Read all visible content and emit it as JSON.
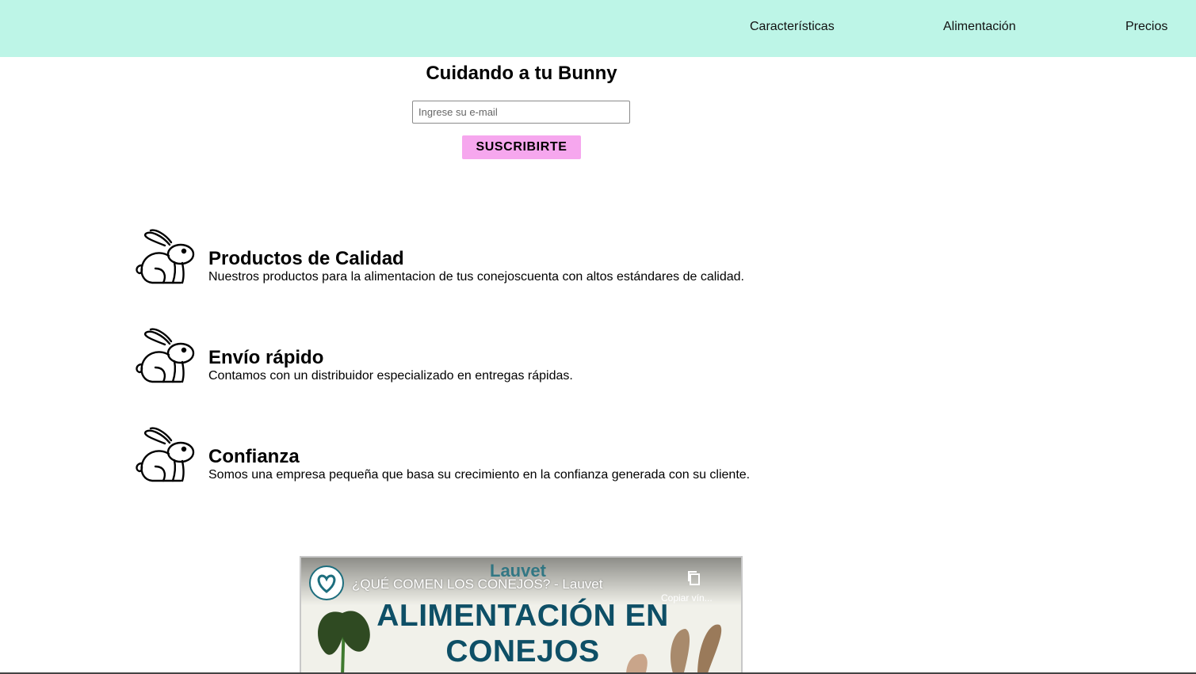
{
  "nav": {
    "items": [
      {
        "label": "Características"
      },
      {
        "label": "Alimentación"
      },
      {
        "label": "Precios"
      }
    ]
  },
  "hero": {
    "title": "Cuidando a tu Bunny",
    "email_placeholder": "Ingrese su e-mail",
    "subscribe_label": "SUSCRIBIRTE"
  },
  "features": [
    {
      "icon": "rabbit-icon",
      "title": "Productos de Calidad",
      "text": "Nuestros productos para la alimentacion de tus conejoscuenta con altos estándares de calidad."
    },
    {
      "icon": "rabbit-icon",
      "title": "Envío rápido",
      "text": "Contamos con un distribuidor especializado en entregas rápidas."
    },
    {
      "icon": "rabbit-icon",
      "title": "Confianza",
      "text": "Somos una empresa pequeña que basa su crecimiento en la confianza generada con su cliente."
    }
  ],
  "video": {
    "title": "¿QUÉ COMEN LOS CONEJOS? - Lauvet",
    "copy_label": "Copiar vín...",
    "brand": "Lauvet",
    "thumb_line1": "ALIMENTACIÓN EN",
    "thumb_line2": "CONEJOS"
  },
  "colors": {
    "navbar_bg": "#bdf5e7",
    "button_bg": "#f6a7ee",
    "thumb_text": "#0e4f66"
  }
}
